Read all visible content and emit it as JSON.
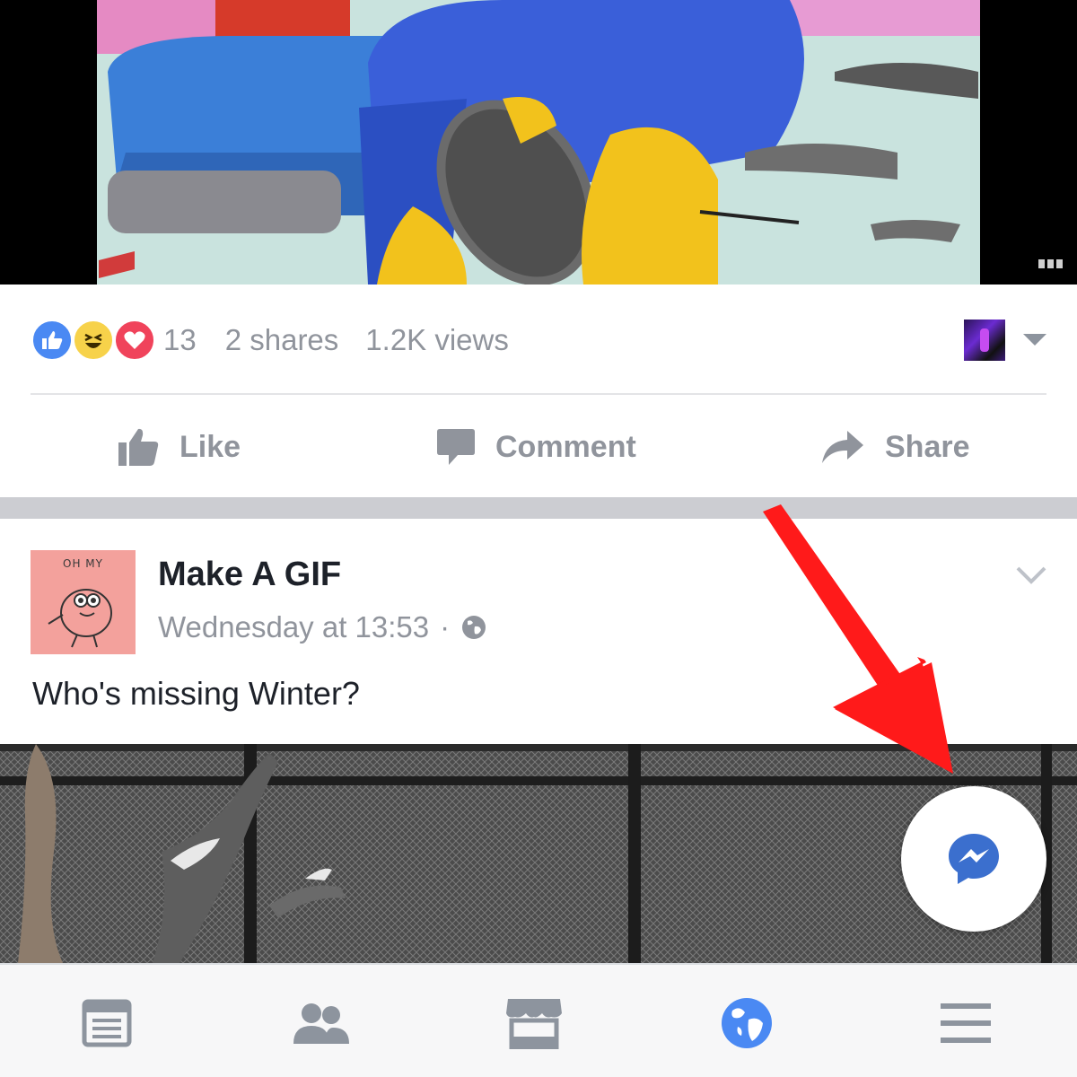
{
  "post1": {
    "reaction_count": "13",
    "shares": "2 shares",
    "views": "1.2K views",
    "reaction_icons": [
      "like-reaction-icon",
      "haha-reaction-icon",
      "love-reaction-icon"
    ]
  },
  "actions": {
    "like_label": "Like",
    "comment_label": "Comment",
    "share_label": "Share"
  },
  "post2": {
    "avatar_text": "OH MY",
    "author": "Make A GIF",
    "timestamp": "Wednesday at 13:53",
    "separator": "·",
    "privacy_icon": "globe-icon",
    "text": "Who's missing Winter?"
  },
  "messenger": {
    "icon": "messenger-icon"
  },
  "tabbar": {
    "tabs": [
      {
        "name": "news-feed",
        "icon": "news-feed-icon",
        "active": false
      },
      {
        "name": "friends",
        "icon": "friends-icon",
        "active": false
      },
      {
        "name": "marketplace",
        "icon": "marketplace-icon",
        "active": false
      },
      {
        "name": "notifications",
        "icon": "globe-icon",
        "active": true
      },
      {
        "name": "menu",
        "icon": "menu-icon",
        "active": false
      }
    ]
  },
  "colors": {
    "accent": "#4a89f3",
    "muted_text": "#90949c",
    "primary_text": "#1d2129",
    "annotation_arrow": "#ff1a1a",
    "separator_band": "#cccdd2"
  }
}
